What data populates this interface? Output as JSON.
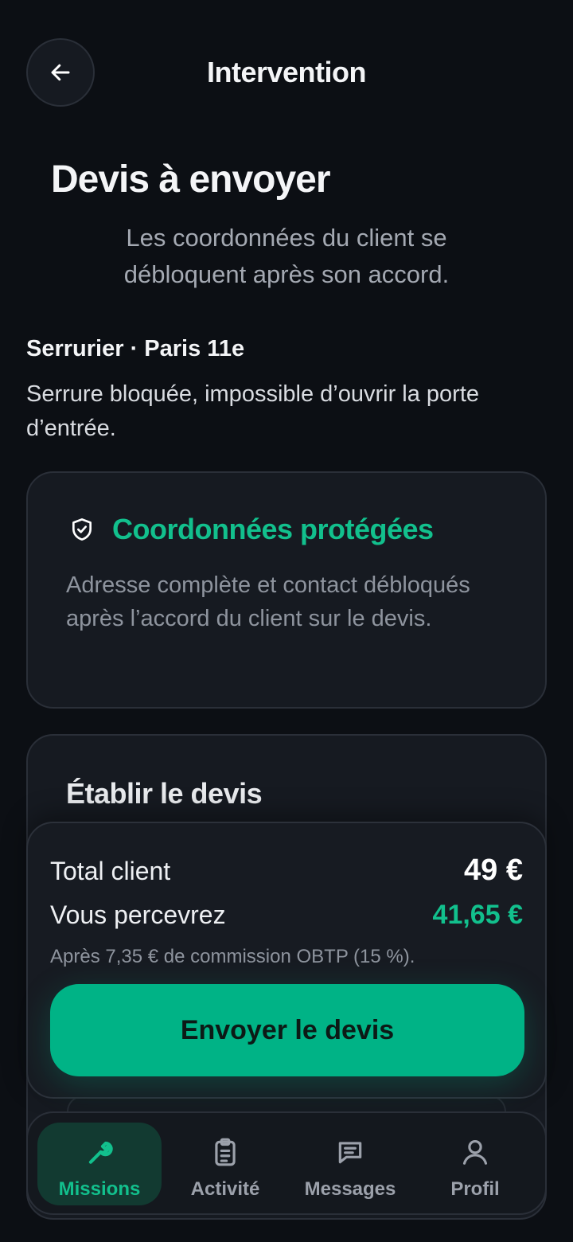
{
  "header": {
    "title": "Intervention"
  },
  "page": {
    "title": "Devis à envoyer",
    "subtitle": "Les coordonnées du client se débloquent après son accord."
  },
  "job": {
    "meta": "Serrurier · Paris 11e",
    "description": "Serrure bloquée, impossible d’ouvrir la porte d’entrée."
  },
  "protection": {
    "icon": "shield-check-icon",
    "title": "Coordonnées protégées",
    "text": "Adresse complète et contact débloqués après l’accord du client sur le devis."
  },
  "devis": {
    "title": "Établir le devis"
  },
  "summary": {
    "total_label": "Total client",
    "total_value": "49 €",
    "net_label": "Vous percevrez",
    "net_value": "41,65 €",
    "commission_note": "Après 7,35 € de commission OBTP (15 %).",
    "send_button": "Envoyer le devis"
  },
  "nav": {
    "items": [
      {
        "label": "Missions",
        "icon": "wrench-icon",
        "active": true
      },
      {
        "label": "Activité",
        "icon": "clipboard-icon",
        "active": false
      },
      {
        "label": "Messages",
        "icon": "chat-icon",
        "active": false
      },
      {
        "label": "Profil",
        "icon": "user-icon",
        "active": false
      }
    ]
  },
  "colors": {
    "accent": "#12c08d",
    "button": "#00b386",
    "background": "#0c0f14",
    "card": "#161a21"
  }
}
